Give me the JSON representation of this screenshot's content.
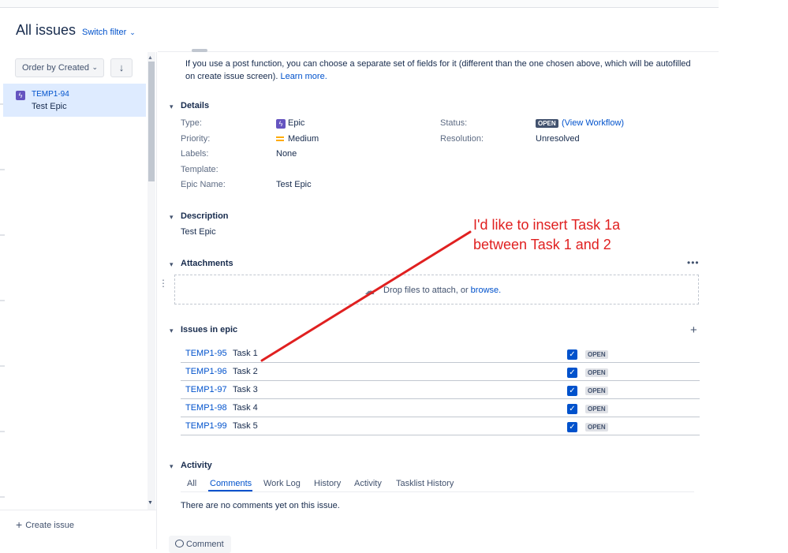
{
  "header": {
    "title": "All issues",
    "switch_filter": "Switch filter"
  },
  "sidebar": {
    "order_label": "Order by Created",
    "sort_icon": "arrow-down-icon",
    "selected_issue": {
      "key": "TEMP1-94",
      "summary": "Test Epic"
    },
    "create_issue": "Create issue"
  },
  "intro": {
    "text": "If you use a post function, you can choose a separate set of fields for it (different than the one chosen above, which will be autofilled on create issue screen).",
    "learn_more": "Learn more."
  },
  "details": {
    "title": "Details",
    "type_label": "Type:",
    "type_value": "Epic",
    "priority_label": "Priority:",
    "priority_value": "Medium",
    "labels_label": "Labels:",
    "labels_value": "None",
    "template_label": "Template:",
    "epic_name_label": "Epic Name:",
    "epic_name_value": "Test Epic",
    "status_label": "Status:",
    "status_badge": "OPEN",
    "status_link": "(View Workflow)",
    "resolution_label": "Resolution:",
    "resolution_value": "Unresolved"
  },
  "description": {
    "title": "Description",
    "text": "Test Epic"
  },
  "attachments": {
    "title": "Attachments",
    "drop_text": "Drop files to attach, or",
    "browse": "browse."
  },
  "issues_in_epic": {
    "title": "Issues in epic",
    "rows": [
      {
        "key": "TEMP1-95",
        "summary": "Task 1",
        "status": "OPEN"
      },
      {
        "key": "TEMP1-96",
        "summary": "Task 2",
        "status": "OPEN"
      },
      {
        "key": "TEMP1-97",
        "summary": "Task 3",
        "status": "OPEN"
      },
      {
        "key": "TEMP1-98",
        "summary": "Task 4",
        "status": "OPEN"
      },
      {
        "key": "TEMP1-99",
        "summary": "Task 5",
        "status": "OPEN"
      }
    ]
  },
  "activity": {
    "title": "Activity",
    "tabs": [
      "All",
      "Comments",
      "Work Log",
      "History",
      "Activity",
      "Tasklist History"
    ],
    "active_tab": "Comments",
    "empty_text": "There are no comments yet on this issue.",
    "comment_button": "Comment"
  },
  "annotation": {
    "line1": "I'd like to insert Task 1a",
    "line2": "between Task 1 and 2",
    "color": "#e02020"
  },
  "colors": {
    "accent": "#0052cc",
    "epic": "#6554c0",
    "priority_medium": "#ffab00"
  }
}
